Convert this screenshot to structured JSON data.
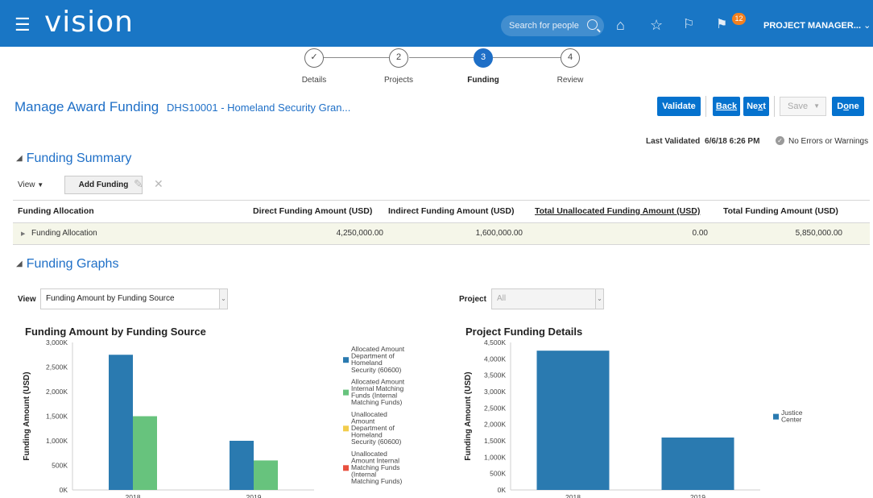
{
  "header": {
    "app_name": "vision",
    "search_placeholder": "Search for people",
    "notification_count": "12",
    "user_label": "PROJECT MANAGER...",
    "color": "#1976c5"
  },
  "train": {
    "steps": [
      {
        "num": "✓",
        "label": "Details"
      },
      {
        "num": "2",
        "label": "Projects"
      },
      {
        "num": "3",
        "label": "Funding"
      },
      {
        "num": "4",
        "label": "Review"
      }
    ],
    "active_step": 3
  },
  "page": {
    "title": "Manage Award Funding",
    "subtitle": "DHS10001 - Homeland Security Gran...",
    "last_validated_label": "Last Validated",
    "last_validated_value": "6/6/18 6:26 PM",
    "validation_status": "No Errors or Warnings"
  },
  "buttons": {
    "validate": "Validate",
    "back": "Back",
    "next_pre": "Ne",
    "next_mnemonic": "x",
    "next_post": "t",
    "save": "Save",
    "done_pre": "D",
    "done_mnemonic": "o",
    "done_post": "ne"
  },
  "funding_summary": {
    "heading": "Funding Summary",
    "view_menu": "View",
    "add_button": "Add Funding",
    "columns": [
      "Funding Allocation",
      "Direct Funding Amount (USD)",
      "Indirect Funding Amount (USD)",
      "Total Unallocated Funding Amount (USD)",
      "Total Funding Amount (USD)"
    ],
    "row": {
      "allocation": "Funding Allocation",
      "direct": "4,250,000.00",
      "indirect": "1,600,000.00",
      "unallocated": "0.00",
      "total": "5,850,000.00"
    }
  },
  "funding_graphs": {
    "heading": "Funding Graphs",
    "view_label": "View",
    "view_value": "Funding Amount by Funding Source",
    "project_label": "Project",
    "project_value": "All"
  },
  "chart_data": [
    {
      "type": "bar",
      "title": "Funding Amount by Funding Source",
      "ylabel": "Funding Amount (USD)",
      "ylim": [
        0,
        3000000
      ],
      "yticks": [
        "0K",
        "500K",
        "1,000K",
        "1,500K",
        "2,000K",
        "2,500K",
        "3,000K"
      ],
      "categories": [
        "2018",
        "2019"
      ],
      "series": [
        {
          "name": "Allocated Amount Department of Homeland Security (60600)",
          "color": "#2a7ab0",
          "values": [
            2750000,
            1000000
          ]
        },
        {
          "name": "Allocated Amount Internal Matching Funds (Internal Matching Funds)",
          "color": "#67c37d",
          "values": [
            1500000,
            600000
          ]
        },
        {
          "name": "Unallocated Amount Department of Homeland Security (60600)",
          "color": "#f2cd4c",
          "values": [
            0,
            0
          ]
        },
        {
          "name": "Unallocated Amount Internal Matching Funds (Internal Matching Funds)",
          "color": "#e8503f",
          "values": [
            0,
            0
          ]
        }
      ],
      "legend_lines": [
        [
          "Allocated Amount",
          "Department of",
          "Homeland",
          "Security (60600)"
        ],
        [
          "Allocated Amount",
          "Internal Matching",
          "Funds (Internal",
          "Matching Funds)"
        ],
        [
          "Unallocated",
          "Amount",
          "Department of",
          "Homeland",
          "Security (60600)"
        ],
        [
          "Unallocated",
          "Amount Internal",
          "Matching Funds",
          "(Internal",
          "Matching Funds)"
        ]
      ],
      "legend": "right",
      "grid": false
    },
    {
      "type": "bar",
      "title": "Project Funding Details",
      "ylabel": "Funding Amount (USD)",
      "ylim": [
        0,
        4500000
      ],
      "yticks": [
        "0K",
        "500K",
        "1,000K",
        "1,500K",
        "2,000K",
        "2,500K",
        "3,000K",
        "3,500K",
        "4,000K",
        "4,500K"
      ],
      "categories": [
        "2018",
        "2019"
      ],
      "series": [
        {
          "name": "Justice Center",
          "color": "#2a7ab0",
          "values": [
            4250000,
            1600000
          ]
        }
      ],
      "legend_lines": [
        [
          "Justice",
          "Center"
        ]
      ],
      "legend": "right",
      "grid": false
    }
  ]
}
